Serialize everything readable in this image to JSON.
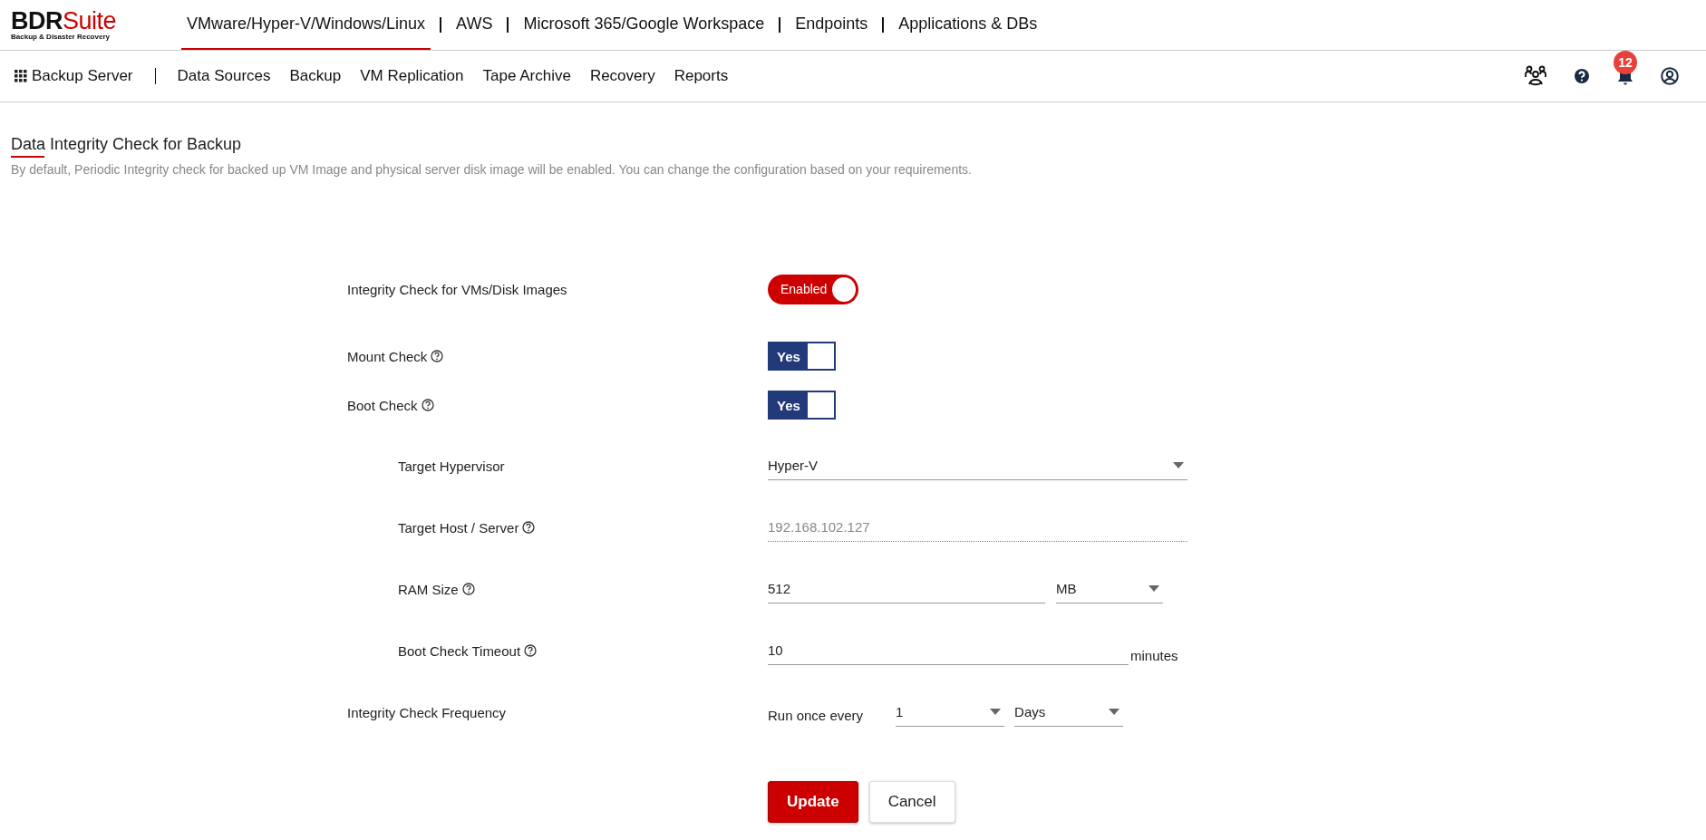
{
  "brand": {
    "name_bold": "BDR",
    "name_light": "Suite",
    "tagline": "Backup & Disaster Recovery"
  },
  "top_nav": [
    {
      "label": "VMware/Hyper-V/Windows/Linux",
      "selected": true
    },
    {
      "label": "AWS",
      "selected": false
    },
    {
      "label": "Microsoft 365/Google Workspace",
      "selected": false
    },
    {
      "label": "Endpoints",
      "selected": false
    },
    {
      "label": "Applications & DBs",
      "selected": false
    }
  ],
  "module_nav": {
    "switcher": "Backup Server",
    "items": [
      {
        "label": "Data Sources",
        "selected": false
      },
      {
        "label": "Backup",
        "selected": false
      },
      {
        "label": "VM Replication",
        "selected": false
      },
      {
        "label": "Tape Archive",
        "selected": false
      },
      {
        "label": "Recovery",
        "selected": false
      },
      {
        "label": "Reports",
        "selected": false
      }
    ]
  },
  "header_actions": {
    "notification_count": "12"
  },
  "page": {
    "title": "Data Integrity Check for Backup",
    "description": "By default, Periodic Integrity check for backed up VM Image and physical server disk image will be enabled. You can change the configuration based on your requirements."
  },
  "form": [
    {
      "kind": "pill",
      "label": "Integrity Check for VMs/Disk Images",
      "help": false,
      "on": true,
      "value": "Enabled"
    },
    {
      "kind": "yesno",
      "label": "Mount Check",
      "help": true,
      "on": true,
      "value": "Yes"
    },
    {
      "kind": "yesno",
      "label": "Boot Check",
      "help": true,
      "on": true,
      "value": "Yes",
      "children": [
        {
          "kind": "select",
          "label": "Target Hypervisor",
          "help": false,
          "value": "Hyper-V"
        },
        {
          "kind": "text",
          "label": "Target Host / Server",
          "help": true,
          "value": "192.168.102.127",
          "disabled": true
        },
        {
          "kind": "unit",
          "label": "RAM Size",
          "help": true,
          "value": "512",
          "unit": "MB"
        },
        {
          "kind": "suffix",
          "label": "Boot Check Timeout",
          "help": true,
          "value": "10",
          "suffix": "minutes"
        }
      ]
    },
    {
      "kind": "frequency",
      "label": "Integrity Check Frequency",
      "help": false,
      "prefix": "Run once every",
      "count": "1",
      "period": "Days"
    }
  ],
  "buttons": [
    {
      "label": "Update",
      "kind": "primary"
    },
    {
      "label": "Cancel",
      "kind": "secondary"
    }
  ]
}
